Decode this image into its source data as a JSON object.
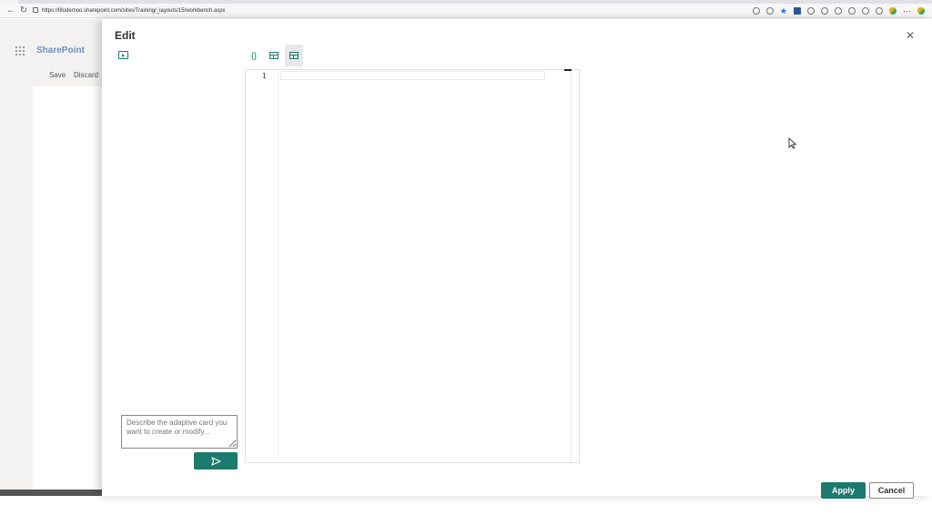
{
  "browser": {
    "url": "https://l8odemoo.sharepoint.com/sites/Training/_layouts/15/workbench.aspx",
    "back_icon": "back-arrow-icon",
    "refresh_icon": "refresh-icon"
  },
  "sharepoint": {
    "brand": "SharePoint",
    "save_label": "Save",
    "discard_label": "Discard"
  },
  "panel": {
    "title": "Edit",
    "close_icon": "close-icon",
    "toolbar": [
      {
        "icon": "json-braces-icon",
        "glyph": "{}",
        "active": false
      },
      {
        "icon": "card-layout-icon",
        "glyph": "",
        "active": false
      },
      {
        "icon": "preview-layout-icon",
        "glyph": "",
        "active": true
      }
    ],
    "editor": {
      "line_number": "1"
    },
    "prompt_placeholder": "Describe the adaptive card you want to create or modify...",
    "send_icon": "send-icon",
    "apply_label": "Apply",
    "cancel_label": "Cancel"
  },
  "colors": {
    "accent": "#1d7a6e",
    "sp_brand": "#6b8fbf"
  }
}
